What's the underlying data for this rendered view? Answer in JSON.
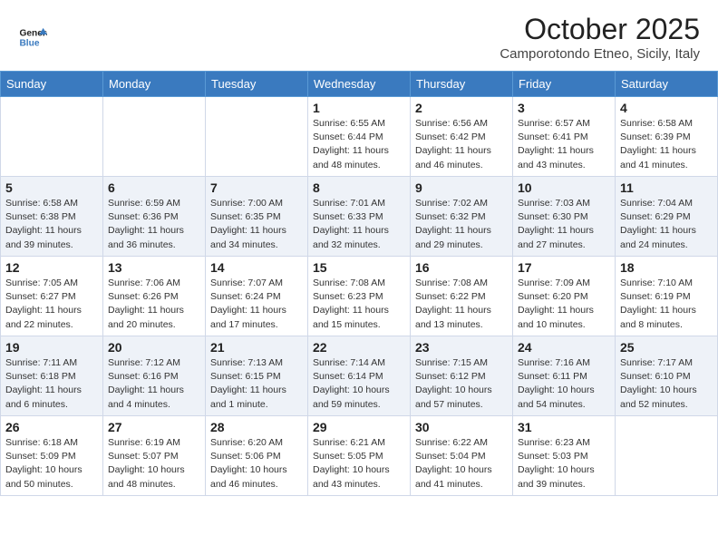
{
  "header": {
    "logo_general": "General",
    "logo_blue": "Blue",
    "month": "October 2025",
    "location": "Camporotondo Etneo, Sicily, Italy"
  },
  "weekdays": [
    "Sunday",
    "Monday",
    "Tuesday",
    "Wednesday",
    "Thursday",
    "Friday",
    "Saturday"
  ],
  "weeks": [
    [
      {
        "day": "",
        "info": ""
      },
      {
        "day": "",
        "info": ""
      },
      {
        "day": "",
        "info": ""
      },
      {
        "day": "1",
        "info": "Sunrise: 6:55 AM\nSunset: 6:44 PM\nDaylight: 11 hours\nand 48 minutes."
      },
      {
        "day": "2",
        "info": "Sunrise: 6:56 AM\nSunset: 6:42 PM\nDaylight: 11 hours\nand 46 minutes."
      },
      {
        "day": "3",
        "info": "Sunrise: 6:57 AM\nSunset: 6:41 PM\nDaylight: 11 hours\nand 43 minutes."
      },
      {
        "day": "4",
        "info": "Sunrise: 6:58 AM\nSunset: 6:39 PM\nDaylight: 11 hours\nand 41 minutes."
      }
    ],
    [
      {
        "day": "5",
        "info": "Sunrise: 6:58 AM\nSunset: 6:38 PM\nDaylight: 11 hours\nand 39 minutes."
      },
      {
        "day": "6",
        "info": "Sunrise: 6:59 AM\nSunset: 6:36 PM\nDaylight: 11 hours\nand 36 minutes."
      },
      {
        "day": "7",
        "info": "Sunrise: 7:00 AM\nSunset: 6:35 PM\nDaylight: 11 hours\nand 34 minutes."
      },
      {
        "day": "8",
        "info": "Sunrise: 7:01 AM\nSunset: 6:33 PM\nDaylight: 11 hours\nand 32 minutes."
      },
      {
        "day": "9",
        "info": "Sunrise: 7:02 AM\nSunset: 6:32 PM\nDaylight: 11 hours\nand 29 minutes."
      },
      {
        "day": "10",
        "info": "Sunrise: 7:03 AM\nSunset: 6:30 PM\nDaylight: 11 hours\nand 27 minutes."
      },
      {
        "day": "11",
        "info": "Sunrise: 7:04 AM\nSunset: 6:29 PM\nDaylight: 11 hours\nand 24 minutes."
      }
    ],
    [
      {
        "day": "12",
        "info": "Sunrise: 7:05 AM\nSunset: 6:27 PM\nDaylight: 11 hours\nand 22 minutes."
      },
      {
        "day": "13",
        "info": "Sunrise: 7:06 AM\nSunset: 6:26 PM\nDaylight: 11 hours\nand 20 minutes."
      },
      {
        "day": "14",
        "info": "Sunrise: 7:07 AM\nSunset: 6:24 PM\nDaylight: 11 hours\nand 17 minutes."
      },
      {
        "day": "15",
        "info": "Sunrise: 7:08 AM\nSunset: 6:23 PM\nDaylight: 11 hours\nand 15 minutes."
      },
      {
        "day": "16",
        "info": "Sunrise: 7:08 AM\nSunset: 6:22 PM\nDaylight: 11 hours\nand 13 minutes."
      },
      {
        "day": "17",
        "info": "Sunrise: 7:09 AM\nSunset: 6:20 PM\nDaylight: 11 hours\nand 10 minutes."
      },
      {
        "day": "18",
        "info": "Sunrise: 7:10 AM\nSunset: 6:19 PM\nDaylight: 11 hours\nand 8 minutes."
      }
    ],
    [
      {
        "day": "19",
        "info": "Sunrise: 7:11 AM\nSunset: 6:18 PM\nDaylight: 11 hours\nand 6 minutes."
      },
      {
        "day": "20",
        "info": "Sunrise: 7:12 AM\nSunset: 6:16 PM\nDaylight: 11 hours\nand 4 minutes."
      },
      {
        "day": "21",
        "info": "Sunrise: 7:13 AM\nSunset: 6:15 PM\nDaylight: 11 hours\nand 1 minute."
      },
      {
        "day": "22",
        "info": "Sunrise: 7:14 AM\nSunset: 6:14 PM\nDaylight: 10 hours\nand 59 minutes."
      },
      {
        "day": "23",
        "info": "Sunrise: 7:15 AM\nSunset: 6:12 PM\nDaylight: 10 hours\nand 57 minutes."
      },
      {
        "day": "24",
        "info": "Sunrise: 7:16 AM\nSunset: 6:11 PM\nDaylight: 10 hours\nand 54 minutes."
      },
      {
        "day": "25",
        "info": "Sunrise: 7:17 AM\nSunset: 6:10 PM\nDaylight: 10 hours\nand 52 minutes."
      }
    ],
    [
      {
        "day": "26",
        "info": "Sunrise: 6:18 AM\nSunset: 5:09 PM\nDaylight: 10 hours\nand 50 minutes."
      },
      {
        "day": "27",
        "info": "Sunrise: 6:19 AM\nSunset: 5:07 PM\nDaylight: 10 hours\nand 48 minutes."
      },
      {
        "day": "28",
        "info": "Sunrise: 6:20 AM\nSunset: 5:06 PM\nDaylight: 10 hours\nand 46 minutes."
      },
      {
        "day": "29",
        "info": "Sunrise: 6:21 AM\nSunset: 5:05 PM\nDaylight: 10 hours\nand 43 minutes."
      },
      {
        "day": "30",
        "info": "Sunrise: 6:22 AM\nSunset: 5:04 PM\nDaylight: 10 hours\nand 41 minutes."
      },
      {
        "day": "31",
        "info": "Sunrise: 6:23 AM\nSunset: 5:03 PM\nDaylight: 10 hours\nand 39 minutes."
      },
      {
        "day": "",
        "info": ""
      }
    ]
  ]
}
